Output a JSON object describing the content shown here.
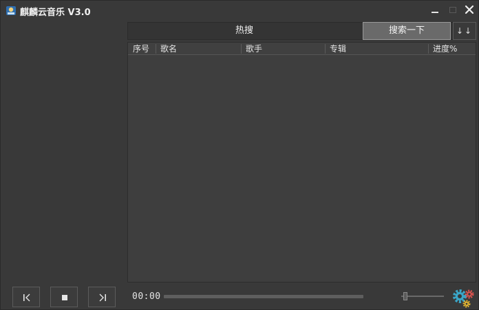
{
  "window": {
    "title": "麒麟云音乐 V3.0",
    "icons": {
      "app": "app-logo-icon",
      "minimize": "minimize-icon",
      "maximize": "maximize-icon",
      "close": "close-icon"
    }
  },
  "search": {
    "hot_label": "热搜",
    "button_label": "搜索一下",
    "sort_label": "↓↓"
  },
  "table": {
    "columns": [
      "序号",
      "歌名",
      "歌手",
      "专辑",
      "进度%"
    ],
    "rows": []
  },
  "player": {
    "time": "00:00",
    "progress": 0,
    "volume": 0.1,
    "icons": {
      "prev": "previous-icon",
      "stop": "stop-icon",
      "next": "next-icon",
      "settings": "gears-icon"
    }
  },
  "colors": {
    "background": "#393939",
    "button_active": "#6a6a6a",
    "gear_blue": "#3aa6c8",
    "gear_red": "#d9534f",
    "gear_yellow": "#e8b930"
  }
}
